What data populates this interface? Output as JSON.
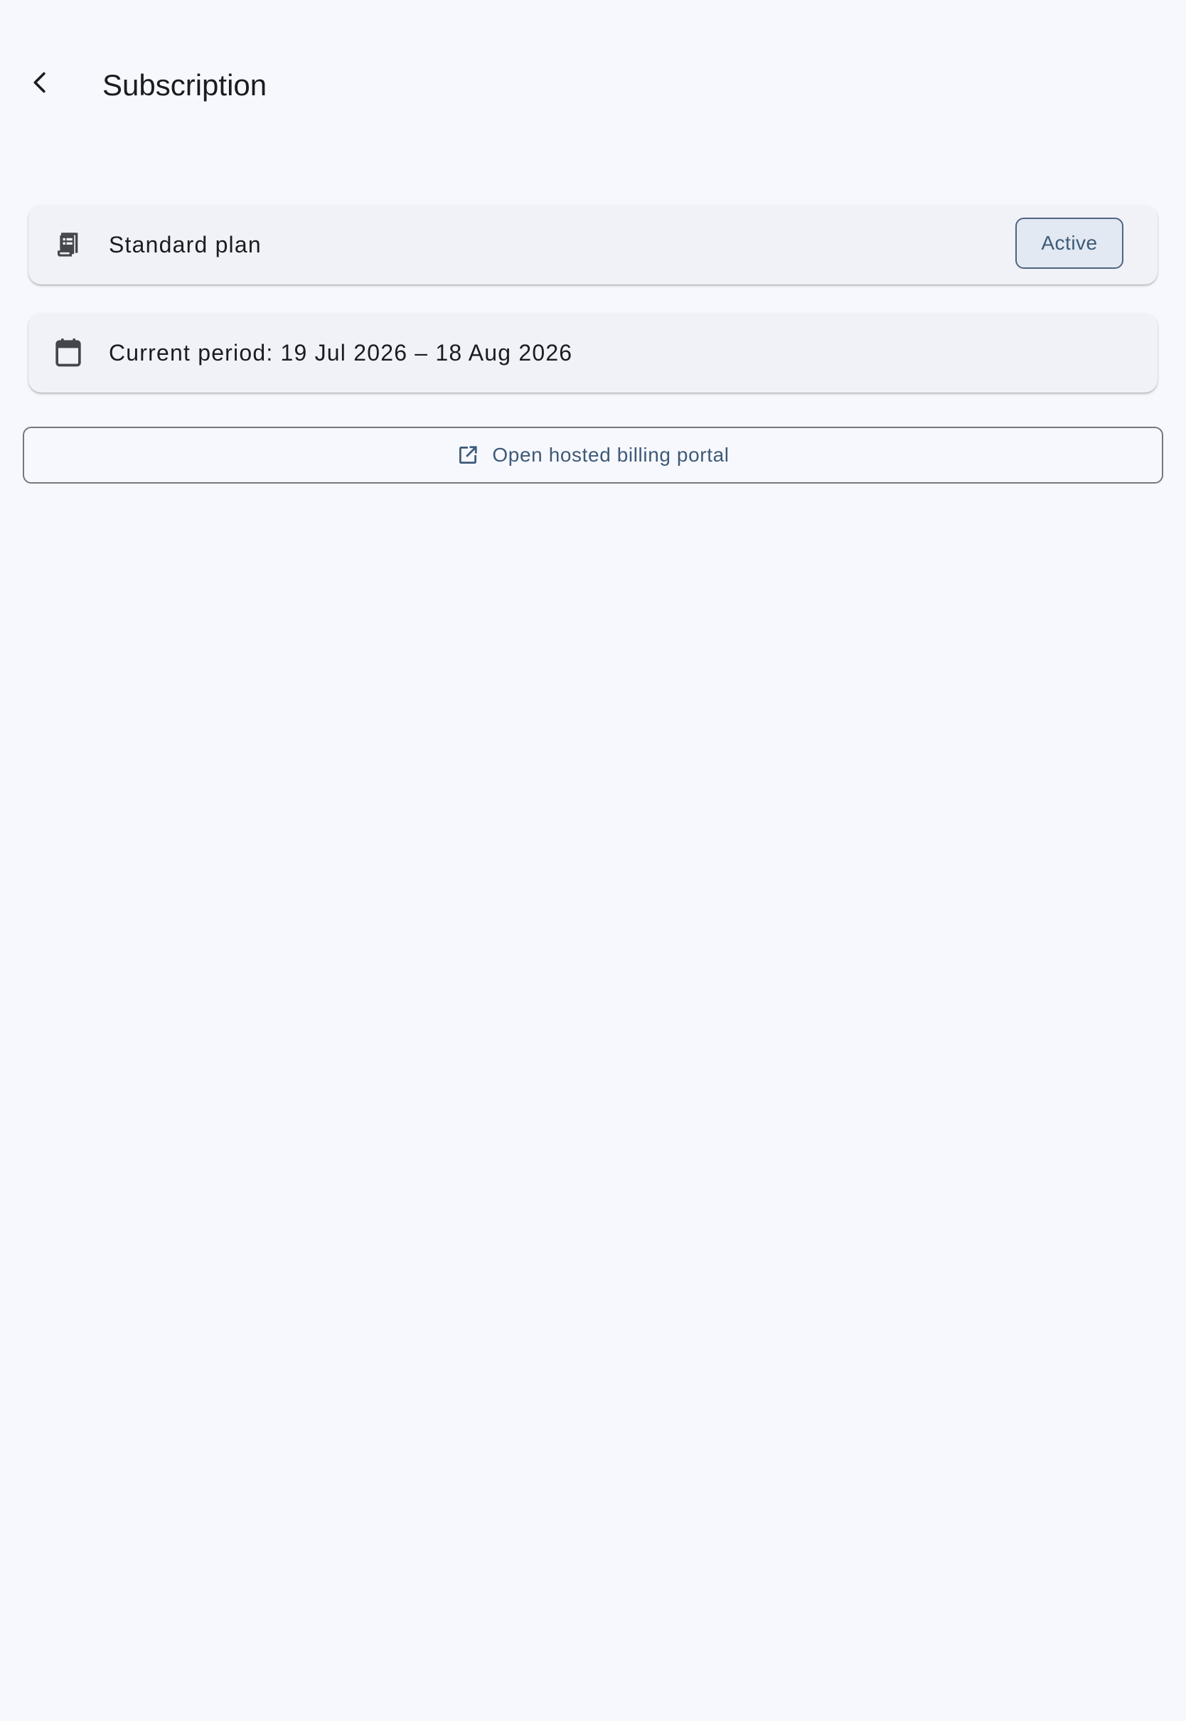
{
  "header": {
    "title": "Subscription",
    "back_icon": "chevron-left-icon"
  },
  "plan_card": {
    "icon": "receipt-icon",
    "label": "Standard plan",
    "status": "Active"
  },
  "period_card": {
    "icon": "calendar-icon",
    "label": "Current period: 19 Jul 2026 – 18 Aug 2026"
  },
  "portal_button": {
    "icon": "open-in-new-icon",
    "label": "Open hosted billing portal"
  },
  "colors": {
    "background": "#f7f8fd",
    "card": "#f1f2f7",
    "accent": "#3d5a78",
    "badge_bg": "#e3e9f2",
    "text": "#1b1c21",
    "outline": "#74777f"
  }
}
